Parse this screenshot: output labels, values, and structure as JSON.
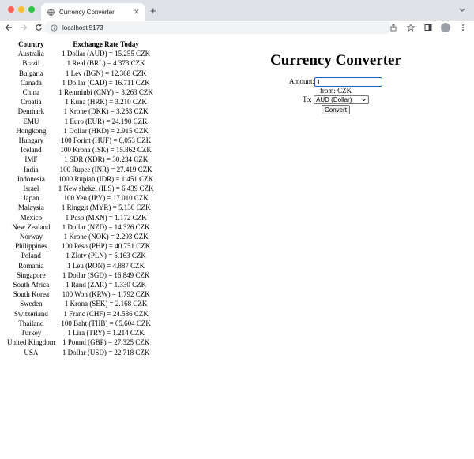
{
  "browser": {
    "tab_title": "Currency Converter",
    "new_tab": "+",
    "url": "localhost:5173"
  },
  "table": {
    "headers": [
      "Country",
      "Exchange Rate Today"
    ],
    "rows": [
      [
        "Australia",
        "1 Dollar (AUD) = 15.255 CZK"
      ],
      [
        "Brazil",
        "1 Real (BRL) = 4.373 CZK"
      ],
      [
        "Bulgaria",
        "1 Lev (BGN) = 12.368 CZK"
      ],
      [
        "Canada",
        "1 Dollar (CAD) = 16.711 CZK"
      ],
      [
        "China",
        "1 Renminbi (CNY) = 3.263 CZK"
      ],
      [
        "Croatia",
        "1 Kuna (HRK) = 3.210 CZK"
      ],
      [
        "Denmark",
        "1 Krone (DKK) = 3.253 CZK"
      ],
      [
        "EMU",
        "1 Euro (EUR) = 24.190 CZK"
      ],
      [
        "Hongkong",
        "1 Dollar (HKD) = 2.915 CZK"
      ],
      [
        "Hungary",
        "100 Forint (HUF) = 6.053 CZK"
      ],
      [
        "Iceland",
        "100 Krona (ISK) = 15.862 CZK"
      ],
      [
        "IMF",
        "1 SDR (XDR) = 30.234 CZK"
      ],
      [
        "India",
        "100 Rupee (INR) = 27.419 CZK"
      ],
      [
        "Indonesia",
        "1000 Rupiah (IDR) = 1.451 CZK"
      ],
      [
        "Israel",
        "1 New shekel (ILS) = 6.439 CZK"
      ],
      [
        "Japan",
        "100 Yen (JPY) = 17.010 CZK"
      ],
      [
        "Malaysia",
        "1 Ringgit (MYR) = 5.136 CZK"
      ],
      [
        "Mexico",
        "1 Peso (MXN) = 1.172 CZK"
      ],
      [
        "New Zealand",
        "1 Dollar (NZD) = 14.326 CZK"
      ],
      [
        "Norway",
        "1 Krone (NOK) = 2.293 CZK"
      ],
      [
        "Philippines",
        "100 Peso (PHP) = 40.751 CZK"
      ],
      [
        "Poland",
        "1 Zloty (PLN) = 5.163 CZK"
      ],
      [
        "Romania",
        "1 Leu (RON) = 4.887 CZK"
      ],
      [
        "Singapore",
        "1 Dollar (SGD) = 16.849 CZK"
      ],
      [
        "South Africa",
        "1 Rand (ZAR) = 1.330 CZK"
      ],
      [
        "South Korea",
        "100 Won (KRW) = 1.792 CZK"
      ],
      [
        "Sweden",
        "1 Krona (SEK) = 2.168 CZK"
      ],
      [
        "Switzerland",
        "1 Franc (CHF) = 24.586 CZK"
      ],
      [
        "Thailand",
        "100 Baht (THB) = 65.604 CZK"
      ],
      [
        "Turkey",
        "1 Lira (TRY) = 1.214 CZK"
      ],
      [
        "United Kingdom",
        "1 Pound (GBP) = 27.325 CZK"
      ],
      [
        "USA",
        "1 Dollar (USD) = 22.718 CZK"
      ]
    ]
  },
  "converter": {
    "title": "Currency Converter",
    "amount_label": "Amount:",
    "amount_value": "1",
    "from_text": "from: CZK",
    "to_label": "To:",
    "to_selected": "AUD (Dollar)",
    "convert_label": "Convert"
  }
}
